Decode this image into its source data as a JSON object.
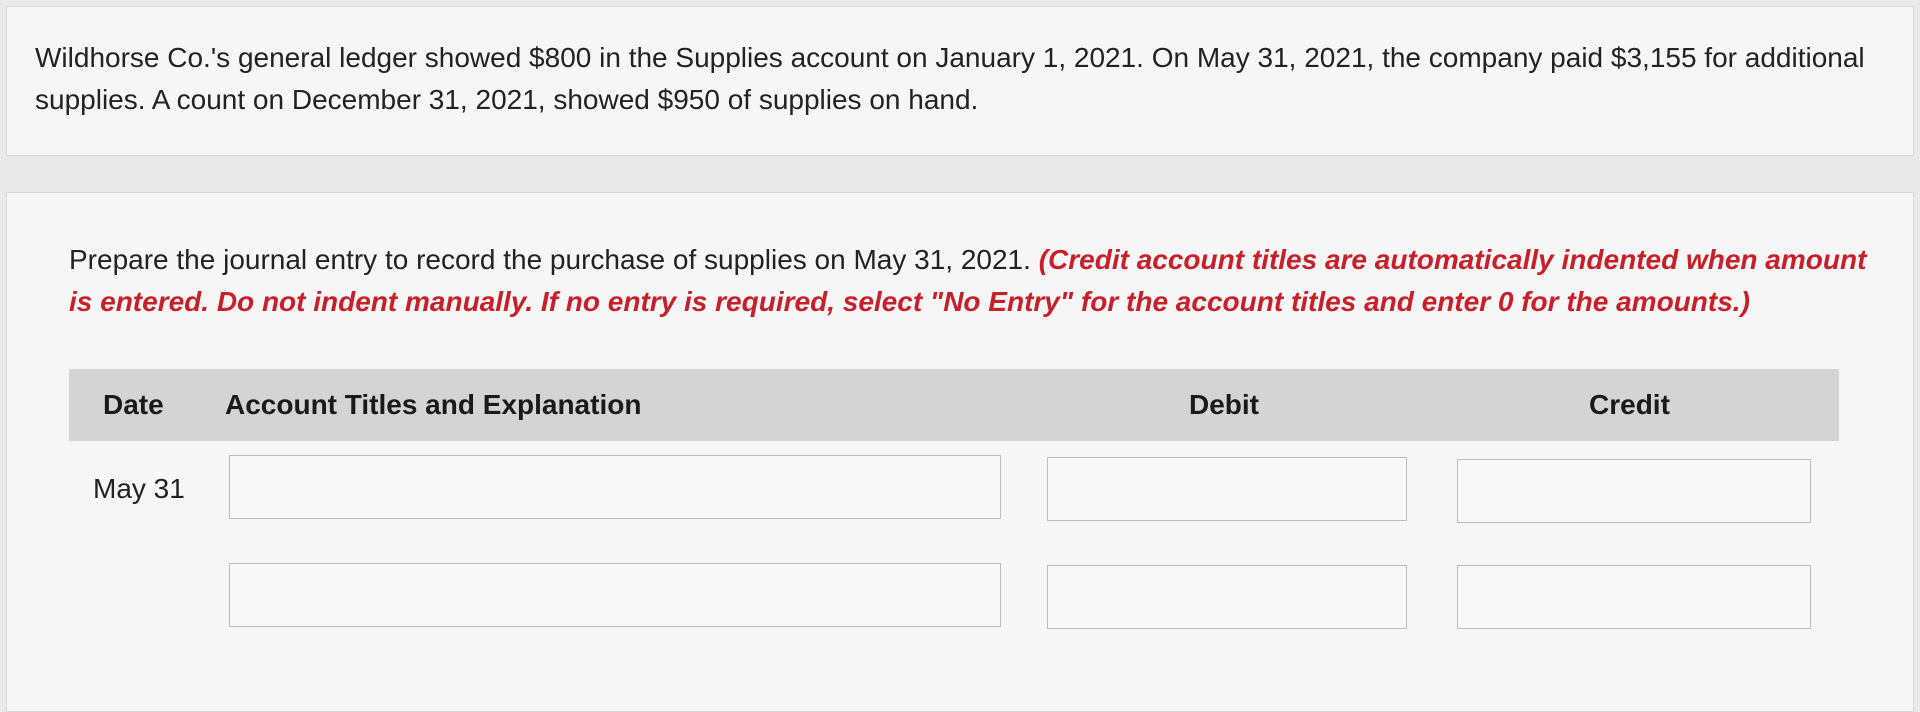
{
  "problem": {
    "text": "Wildhorse Co.'s general ledger showed $800 in the Supplies account on January 1, 2021. On May 31, 2021, the company paid $3,155 for additional supplies. A count on December 31, 2021, showed $950 of supplies on hand."
  },
  "task": {
    "instruction": "Prepare the journal entry to record the purchase of supplies on May 31, 2021.",
    "note": "(Credit account titles are automatically indented when amount is entered. Do not indent manually. If no entry is required, select \"No Entry\" for the account titles and enter 0 for the amounts.)"
  },
  "table": {
    "headers": {
      "date": "Date",
      "account": "Account Titles and Explanation",
      "debit": "Debit",
      "credit": "Credit"
    },
    "rows": [
      {
        "date": "May 31",
        "account": "",
        "debit": "",
        "credit": ""
      },
      {
        "date": "",
        "account": "",
        "debit": "",
        "credit": ""
      }
    ]
  }
}
